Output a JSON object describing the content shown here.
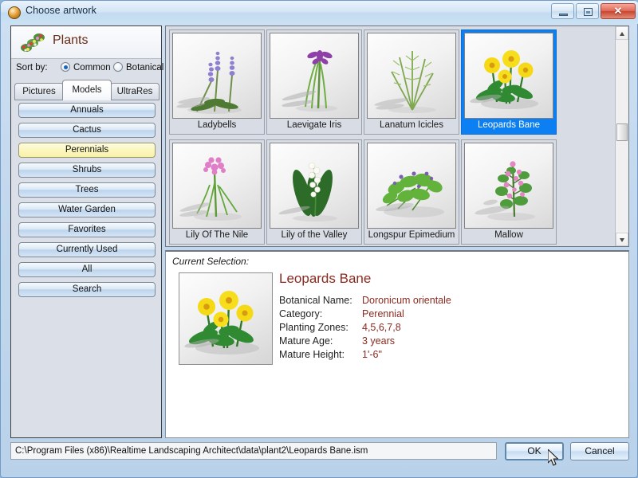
{
  "window": {
    "title": "Choose artwork",
    "icon": "app-globe-icon",
    "minimize_label": "–",
    "maximize_label": "□",
    "close_label": "✕"
  },
  "sidebar": {
    "header_title": "Plants",
    "header_icon": "flowers-icon",
    "sort": {
      "label": "Sort by:",
      "options": [
        {
          "label": "Common",
          "selected": true
        },
        {
          "label": "Botanical",
          "selected": false
        }
      ]
    },
    "tabs": [
      {
        "label": "Pictures",
        "active": false
      },
      {
        "label": "Models",
        "active": true
      },
      {
        "label": "UltraRes",
        "active": false
      }
    ],
    "categories": [
      {
        "label": "Annuals",
        "selected": false
      },
      {
        "label": "Cactus",
        "selected": false
      },
      {
        "label": "Perennials",
        "selected": true
      },
      {
        "label": "Shrubs",
        "selected": false
      },
      {
        "label": "Trees",
        "selected": false
      },
      {
        "label": "Water Garden",
        "selected": false
      },
      {
        "label": "Favorites",
        "selected": false
      },
      {
        "label": "Currently Used",
        "selected": false
      },
      {
        "label": "All",
        "selected": false
      },
      {
        "label": "Search",
        "selected": false
      }
    ]
  },
  "browser": {
    "items": [
      {
        "label": "Ladybells",
        "selected": false,
        "art": "ladybells"
      },
      {
        "label": "Laevigate Iris",
        "selected": false,
        "art": "iris"
      },
      {
        "label": "Lanatum Icicles",
        "selected": false,
        "art": "icicles"
      },
      {
        "label": "Leopards Bane",
        "selected": true,
        "art": "leopardsbane"
      },
      {
        "label": "Lily Of The Nile",
        "selected": false,
        "art": "nile"
      },
      {
        "label": "Lily of the Valley",
        "selected": false,
        "art": "valley"
      },
      {
        "label": "Longspur Epimedium",
        "selected": false,
        "art": "epimedium"
      },
      {
        "label": "Mallow",
        "selected": false,
        "art": "mallow"
      }
    ],
    "scrollbar": {
      "up_arrow": "scroll-up",
      "down_arrow": "scroll-down"
    }
  },
  "detail": {
    "section_label": "Current Selection:",
    "name": "Leopards Bane",
    "fields": [
      {
        "key": "Botanical Name:",
        "value": "Doronicum orientale"
      },
      {
        "key": "Category:",
        "value": "Perennial"
      },
      {
        "key": "Planting Zones:",
        "value": "4,5,6,7,8"
      },
      {
        "key": "Mature Age:",
        "value": "3 years"
      },
      {
        "key": "Mature Height:",
        "value": "1'-6\""
      }
    ]
  },
  "footer": {
    "path": "C:\\Program Files (x86)\\Realtime Landscaping Architect\\data\\plant2\\Leopards Bane.ism",
    "ok_label": "OK",
    "cancel_label": "Cancel"
  },
  "colors": {
    "selection_blue": "#0c7ff2",
    "category_selected": "#fbf7bd",
    "detail_accent": "#8a2a20",
    "title_text": "#6a2b16"
  }
}
